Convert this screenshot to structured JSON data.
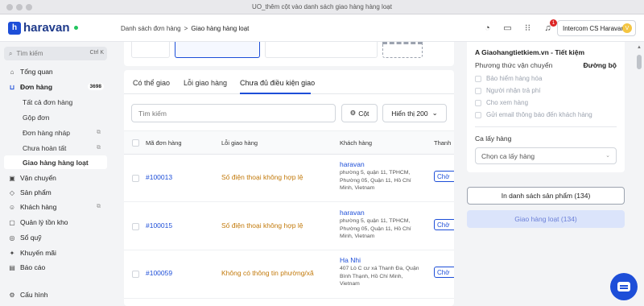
{
  "window": {
    "title": "UO_thêm cột vào danh sách giao hàng hàng loạt"
  },
  "header": {
    "logo_text": "haravan",
    "breadcrumb": [
      "Danh sách đơn hàng",
      "Giao hàng hàng loạt"
    ],
    "breadcrumb_sep": ">",
    "notification_count": "1",
    "store_name": "Intercom CS Haravan",
    "avatar_initial": "V"
  },
  "sidebar": {
    "search_placeholder": "Tìm kiếm",
    "search_shortcut": "Ctrl K",
    "items": [
      {
        "label": "Tổng quan",
        "icon": "home-icon"
      },
      {
        "label": "Đơn hàng",
        "icon": "cart-icon",
        "count": "3698"
      },
      {
        "label": "Tất cả đơn hàng"
      },
      {
        "label": "Gộp đơn"
      },
      {
        "label": "Đơn hàng nháp"
      },
      {
        "label": "Chưa hoàn tất"
      },
      {
        "label": "Giao hàng hàng loạt"
      },
      {
        "label": "Vận chuyển",
        "icon": "truck-icon"
      },
      {
        "label": "Sản phẩm",
        "icon": "tag-icon"
      },
      {
        "label": "Khách hàng",
        "icon": "user-icon"
      },
      {
        "label": "Quản lý tồn kho",
        "icon": "box-icon"
      },
      {
        "label": "Sổ quỹ",
        "icon": "wallet-icon"
      },
      {
        "label": "Khuyến mãi",
        "icon": "gift-icon"
      },
      {
        "label": "Báo cáo",
        "icon": "chart-icon"
      },
      {
        "label": "Cấu hình",
        "icon": "gear-icon"
      }
    ]
  },
  "main": {
    "tabs": [
      "Có thể giao",
      "Lỗi giao hàng",
      "Chưa đủ điều kiện giao"
    ],
    "search_placeholder": "Tìm kiếm",
    "column_button": "Cột",
    "show_select": "Hiển thị 200",
    "columns": [
      "Mã đơn hàng",
      "Lỗi giao hàng",
      "Khách hàng",
      "Thanh"
    ],
    "rows": [
      {
        "order": "#100013",
        "error": "Số điện thoại không hợp lệ",
        "customer": "haravan",
        "address": "phường 5, quận 11, TPHCM, Phường 05, Quận 11, Hồ Chí Minh, Vietnam",
        "status": "Chờ"
      },
      {
        "order": "#100015",
        "error": "Số điện thoại không hợp lệ",
        "customer": "haravan",
        "address": "phường 5, quận 11, TPHCM, Phường 05, Quận 11, Hồ Chí Minh, Vietnam",
        "status": "Chờ"
      },
      {
        "order": "#100059",
        "error": "Không có thông tin phường/xã",
        "customer": "Ha Nhi",
        "address": "407 Lò C cư xá Thanh Đa, Quận Bình Thạnh, Hồ Chí Minh, Vietnam",
        "status": "Chờ"
      }
    ]
  },
  "panel": {
    "title": "A Giaohangtietkiem.vn - Tiết kiệm",
    "method_label": "Phương thức vận chuyển",
    "method_value": "Đường bộ",
    "options": [
      "Bảo hiểm hàng hóa",
      "Người nhận trả phí",
      "Cho xem hàng",
      "Gửi email thông báo đến khách hàng"
    ],
    "shift_label": "Ca lấy hàng",
    "shift_placeholder": "Chọn ca lấy hàng",
    "print_button": "In danh sách sản phẩm (134)",
    "ship_button": "Giao hàng loạt (134)"
  }
}
